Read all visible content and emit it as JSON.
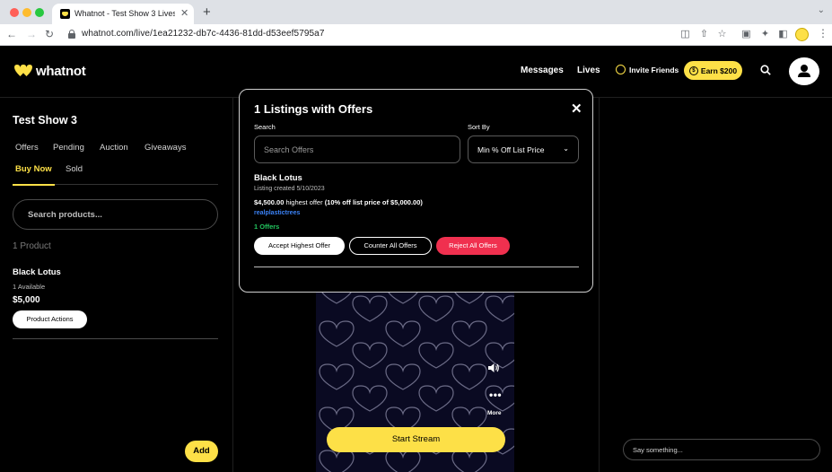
{
  "browser": {
    "tab_title": "Whatnot - Test Show 3 Livestr",
    "tab_close": "✕",
    "new_tab": "+",
    "url": "whatnot.com/live/1ea21232-db7c-4436-81dd-d53eef5795a7"
  },
  "header": {
    "logo": "whatnot",
    "messages": "Messages",
    "lives": "Lives",
    "invite": "Invite Friends",
    "earn": "Earn $200",
    "earn_symbol": "$"
  },
  "sidebar": {
    "show_title": "Test Show 3",
    "tabs": [
      "Offers",
      "Pending",
      "Auction",
      "Giveaways",
      "Buy Now",
      "Sold"
    ],
    "active_tab": "Buy Now",
    "search_placeholder": "Search products...",
    "product_count": "1 Product",
    "product": {
      "name": "Black Lotus",
      "availability": "1 Available",
      "price": "$5,000",
      "actions_label": "Product Actions"
    },
    "add_label": "Add"
  },
  "stream": {
    "more_label": "More",
    "start_label": "Start Stream"
  },
  "chat": {
    "placeholder": "Say something..."
  },
  "modal": {
    "title": "1 Listings with Offers",
    "close": "✕",
    "search_label": "Search",
    "search_placeholder": "Search Offers",
    "sort_label": "Sort By",
    "sort_value": "Min % Off List Price",
    "listing": {
      "name": "Black Lotus",
      "created": "Listing created 5/10/2023",
      "highest_amount": "$4,500.00",
      "highest_text": " highest offer ",
      "off_note": "(10% off list price of $5,000.00)",
      "user": "realplastictrees",
      "offer_count": "1 Offers"
    },
    "accept_label": "Accept Highest Offer",
    "counter_label": "Counter All Offers",
    "reject_label": "Reject All Offers"
  },
  "colors": {
    "brand_yellow": "#fde047",
    "reject_red": "#f0304f",
    "user_blue": "#3b82f6",
    "offers_green": "#22c55e"
  }
}
